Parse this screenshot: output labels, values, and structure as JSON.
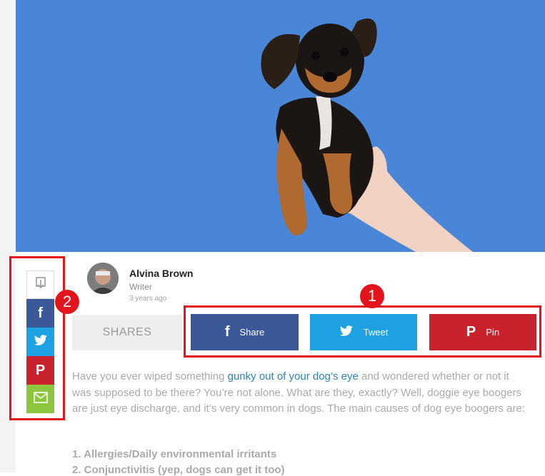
{
  "author": {
    "name": "Alvina Brown",
    "role": "Writer",
    "time_ago": "3 years ago"
  },
  "shares": {
    "label": "SHARES",
    "buttons": [
      {
        "label": "Share",
        "icon": "facebook-icon",
        "color": "#3b5998"
      },
      {
        "label": "Tweet",
        "icon": "twitter-icon",
        "color": "#1da1e2"
      },
      {
        "label": "Pin",
        "icon": "pinterest-icon",
        "color": "#c8232c"
      }
    ]
  },
  "side_rail": {
    "items": [
      {
        "icon": "save-icon",
        "color": "#ffffff"
      },
      {
        "icon": "facebook-icon",
        "color": "#3b5998"
      },
      {
        "icon": "twitter-icon",
        "color": "#1da1e2"
      },
      {
        "icon": "pinterest-icon",
        "color": "#c8232c"
      },
      {
        "icon": "email-icon",
        "color": "#8cc63f"
      }
    ]
  },
  "annotations": {
    "badge_1": "1",
    "badge_2": "2",
    "color": "#e3141b"
  },
  "article": {
    "p1_before": "Have you ever wiped something ",
    "p1_link": "gunky out of your dog’s eye",
    "p1_after": " and wondered whether or not it was supposed to be there? You’re not alone. What are they, exactly? Well, doggie eye boogers are just eye discharge, and it’s very common in dogs. The main causes of dog eye boogers are:",
    "list": [
      "1. Allergies/Daily environmental irritants",
      "2. Conjunctivitis (yep, dogs can get it too)"
    ]
  }
}
